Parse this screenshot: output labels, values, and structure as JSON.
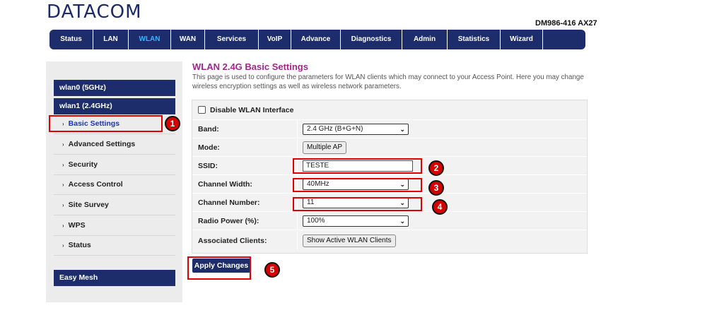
{
  "brand": {
    "logo": "DATACOM",
    "model": "DM986-416 AX27"
  },
  "nav": [
    {
      "label": "Status"
    },
    {
      "label": "LAN"
    },
    {
      "label": "WLAN"
    },
    {
      "label": "WAN"
    },
    {
      "label": "Services"
    },
    {
      "label": "VoIP"
    },
    {
      "label": "Advance"
    },
    {
      "label": "Diagnostics"
    },
    {
      "label": "Admin"
    },
    {
      "label": "Statistics"
    },
    {
      "label": "Wizard"
    }
  ],
  "nav_active": "WLAN",
  "sidebar": {
    "wlan0": "wlan0 (5GHz)",
    "wlan1": "wlan1 (2.4GHz)",
    "items": [
      {
        "label": "Basic Settings"
      },
      {
        "label": "Advanced Settings"
      },
      {
        "label": "Security"
      },
      {
        "label": "Access Control"
      },
      {
        "label": "Site Survey"
      },
      {
        "label": "WPS"
      },
      {
        "label": "Status"
      }
    ],
    "mesh": "Easy Mesh"
  },
  "page": {
    "title": "WLAN 2.4G Basic Settings",
    "description": "This page is used to configure the parameters for WLAN clients which may connect to your Access Point. Here you may change wireless encryption settings as well as wireless network parameters."
  },
  "form": {
    "disable_label": "Disable WLAN Interface",
    "disable_checked": false,
    "band_label": "Band:",
    "band_value": "2.4 GHz (B+G+N)",
    "mode_label": "Mode:",
    "mode_button": "Multiple AP",
    "ssid_label": "SSID:",
    "ssid_value": "TESTE",
    "width_label": "Channel Width:",
    "width_value": "40MHz",
    "channel_label": "Channel Number:",
    "channel_value": "11",
    "power_label": "Radio Power (%):",
    "power_value": "100%",
    "clients_label": "Associated Clients:",
    "clients_button": "Show Active WLAN Clients"
  },
  "apply_label": "Apply Changes",
  "badges": [
    "1",
    "2",
    "3",
    "4",
    "5"
  ],
  "colors": {
    "navy": "#1d2d6b",
    "active_nav": "#36b4ff",
    "title": "#a0268e",
    "highlight": "#e00000"
  }
}
